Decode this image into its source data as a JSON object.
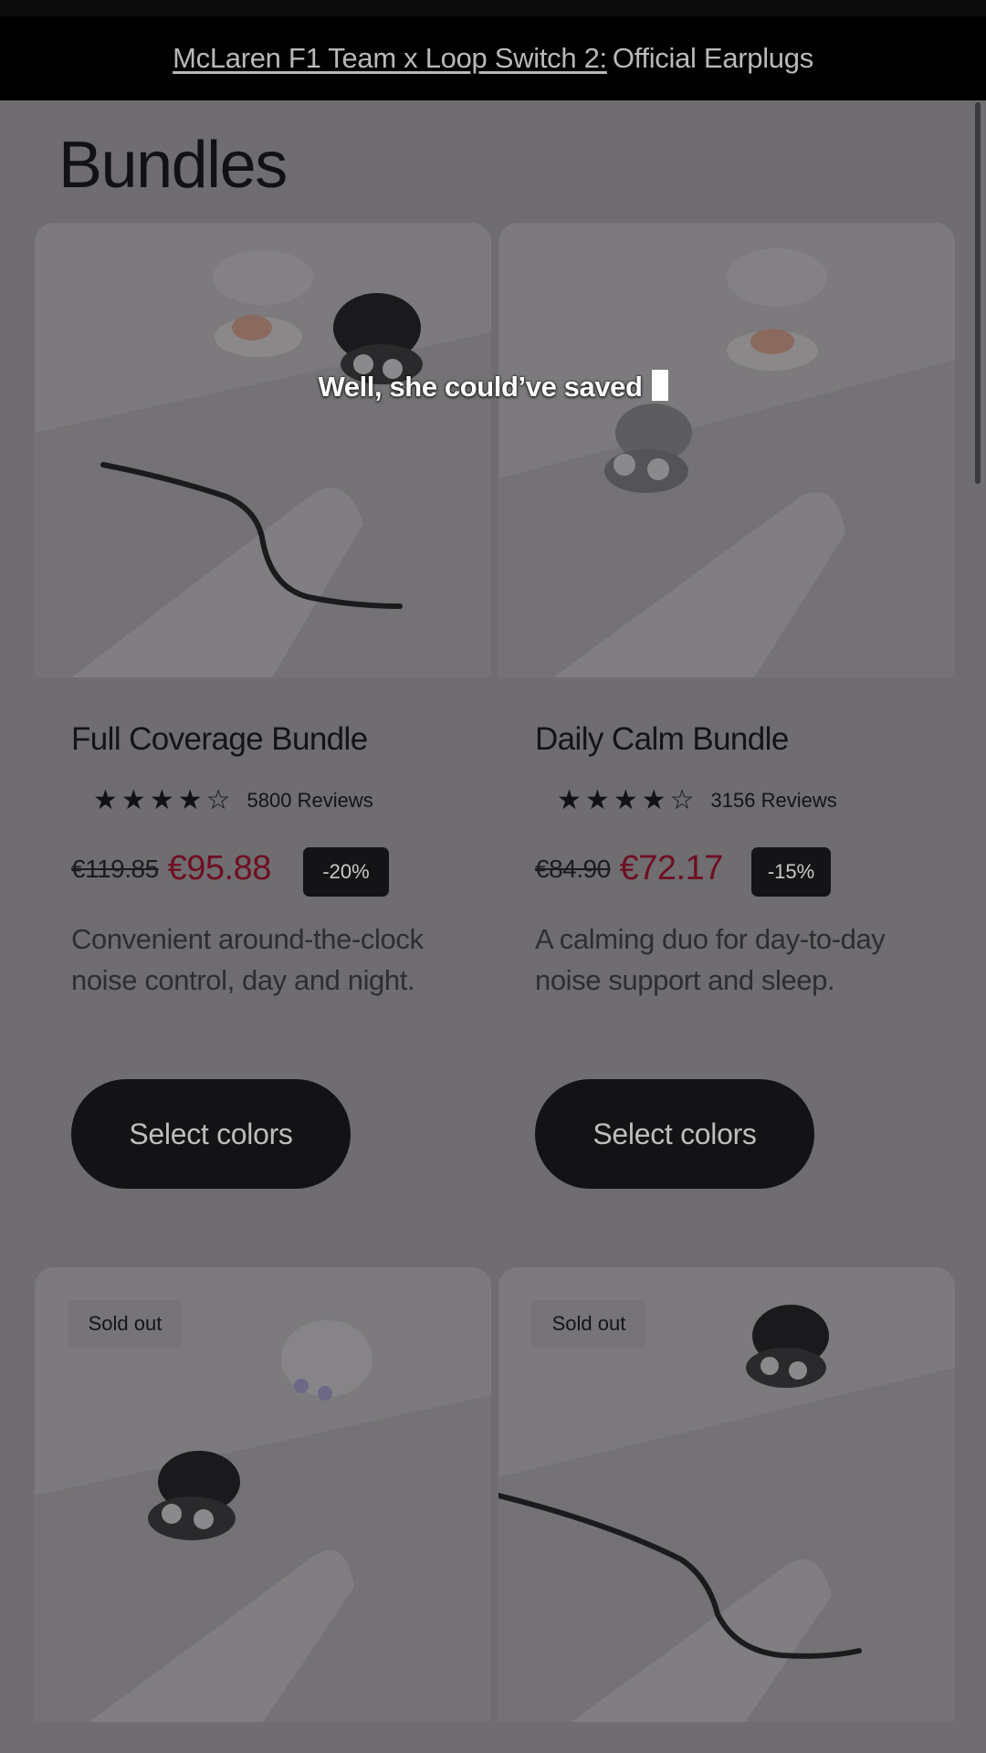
{
  "banner": {
    "link_text": "McLaren F1 Team x Loop Switch 2:",
    "rest_text": "Official Earplugs"
  },
  "page_title": "Bundles",
  "caption": "Well, she could’ve saved",
  "products": [
    {
      "title": "Full Coverage Bundle",
      "rating": 4.5,
      "reviews": "5800 Reviews",
      "old_price": "€119.85",
      "new_price": "€95.88",
      "discount": "-20%",
      "description": "Convenient around-the-clock noise control, day and night.",
      "button": "Select colors"
    },
    {
      "title": "Daily Calm Bundle",
      "rating": 4.5,
      "reviews": "3156 Reviews",
      "old_price": "€84.90",
      "new_price": "€72.17",
      "discount": "-15%",
      "description": "A calming duo for day-to-day noise support and sleep.",
      "button": "Select colors"
    }
  ],
  "second_row": [
    {
      "badge": "Sold out"
    },
    {
      "badge": "Sold out"
    }
  ],
  "icons": {
    "star": "star-icon",
    "half_star": "half-star-icon"
  },
  "colors": {
    "sale_price": "#6e0f22",
    "button_bg": "#131215",
    "overlay_bg": "#6f6d70"
  }
}
